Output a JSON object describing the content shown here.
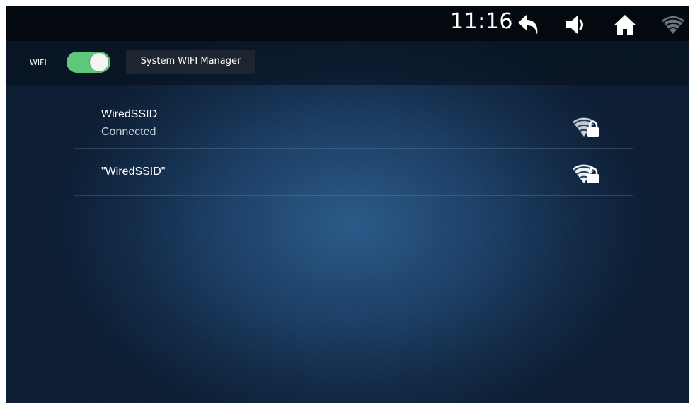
{
  "status_bar": {
    "time": "11:16",
    "icons": [
      "back-icon",
      "volume-icon",
      "home-icon",
      "wifi-signal-icon"
    ]
  },
  "header": {
    "wifi_label": "WIFI",
    "wifi_enabled": true,
    "manager_button_label": "System WIFI Manager"
  },
  "networks": [
    {
      "ssid": "WiredSSID",
      "status": "Connected",
      "icon": "wifi-lock-icon"
    },
    {
      "ssid": "\"WiredSSID\"",
      "icon": "wifi-lock-icon"
    }
  ],
  "colors": {
    "toggle_on": "#5fc97b",
    "status_bar_bg": "#04080f",
    "accent_bg": "#1c3f66"
  }
}
